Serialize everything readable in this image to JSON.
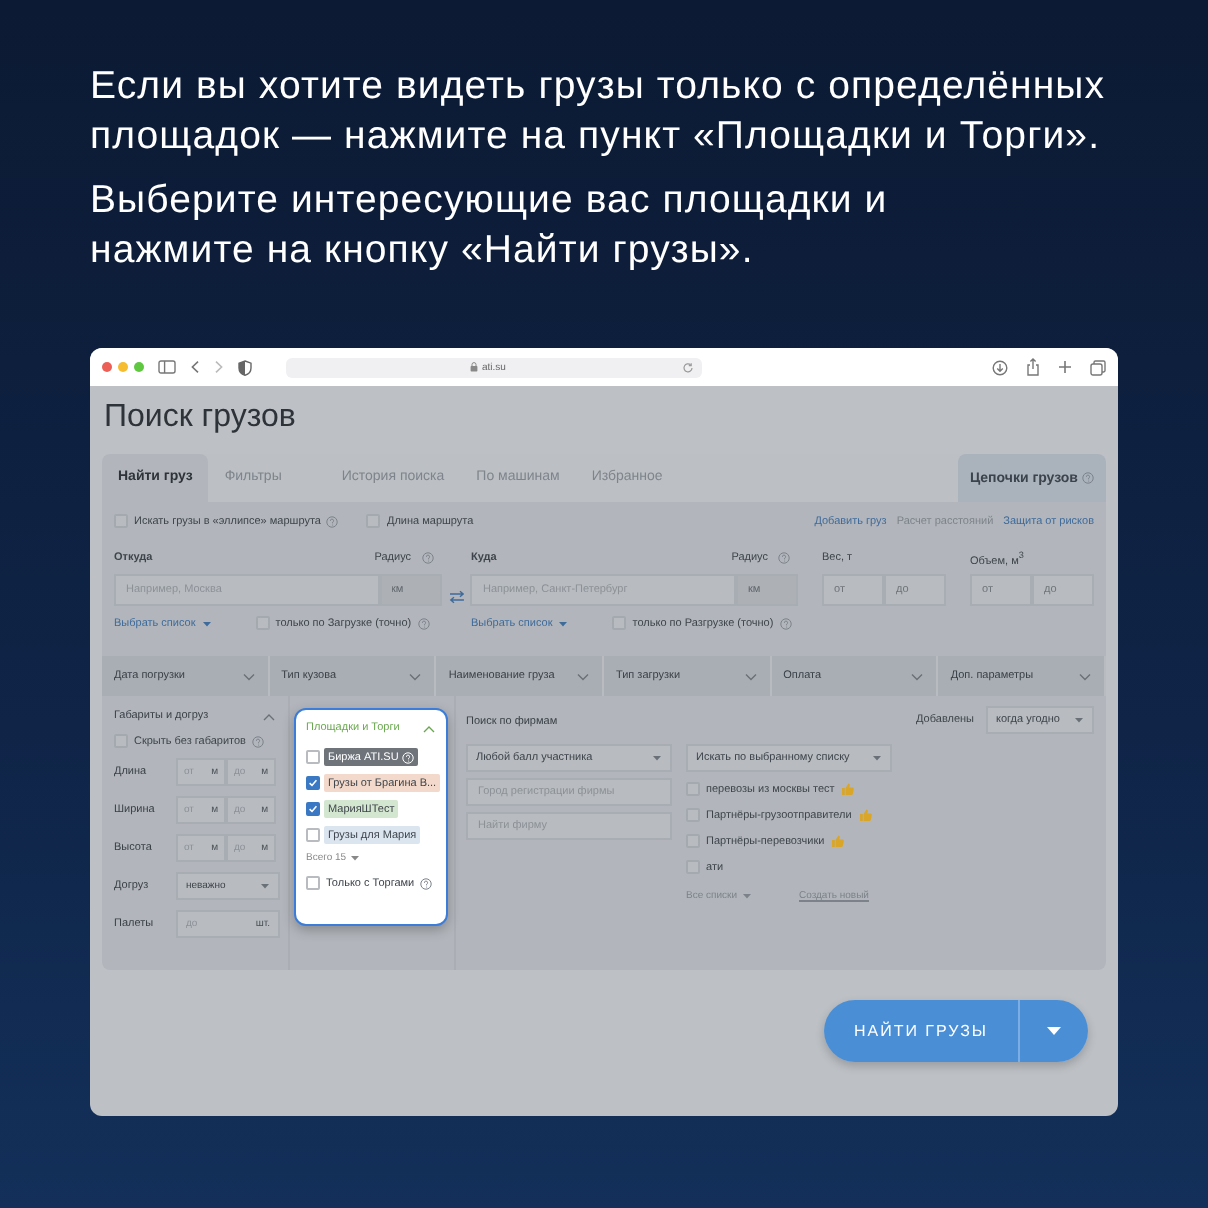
{
  "intro": [
    "Если вы хотите видеть грузы только с определённых площадок — нажмите на пункт «Площадки и Торги».",
    "Выберите интересующие вас площадки и нажмите на кнопку «Найти грузы»."
  ],
  "browser": {
    "address": "ati.su"
  },
  "page_title": "Поиск грузов",
  "tabs": [
    {
      "label": "Найти груз",
      "selected": true
    },
    {
      "label": "Фильтры",
      "selected": false
    },
    {
      "label": "История поиска",
      "selected": false
    },
    {
      "label": "По машинам",
      "selected": false
    },
    {
      "label": "Избранное",
      "selected": false
    }
  ],
  "chains_tab": {
    "label": "Цепочки грузов"
  },
  "options": [
    {
      "label": "Искать грузы в «эллипсе» маршрута",
      "checked": false,
      "help": true
    },
    {
      "label": "Длина маршрута",
      "checked": false,
      "help": false
    }
  ],
  "links": [
    {
      "label": "Добавить груз",
      "disabled": false
    },
    {
      "label": "Расчет расстояний",
      "disabled": true
    },
    {
      "label": "Защита от рисков",
      "disabled": false
    }
  ],
  "route": [
    {
      "label": "Откуда",
      "placeholder": "Например, Москва",
      "radius_label": "Радиус",
      "radius_placeholder": "км",
      "list_link": "Выбрать список",
      "exact": {
        "label": "только по Загрузке (точно)",
        "checked": false
      }
    },
    {
      "label": "Куда",
      "placeholder": "Например, Санкт-Петербург",
      "radius_label": "Радиус",
      "radius_placeholder": "км",
      "list_link": "Выбрать список",
      "exact": {
        "label": "только по Разгрузке (точно)",
        "checked": false
      }
    }
  ],
  "ranges": [
    {
      "label": "Вес, т",
      "from_placeholder": "от",
      "to_placeholder": "до"
    },
    {
      "label": "Объем, м$^{3}$",
      "from_placeholder": "от",
      "to_placeholder": "до"
    }
  ],
  "filter_columns": [
    "Дата погрузки",
    "Тип кузова",
    "Наименование груза",
    "Тип загрузки",
    "Оплата",
    "Доп. параметры"
  ],
  "dimensions": {
    "title": "Габариты и догруз",
    "hide": {
      "label": "Скрыть без габаритов",
      "checked": false
    },
    "rows": [
      {
        "label": "Длина",
        "from": "от",
        "from_unit": "м",
        "to": "до",
        "to_unit": "м"
      },
      {
        "label": "Ширина",
        "from": "от",
        "from_unit": "м",
        "to": "до",
        "to_unit": "м"
      },
      {
        "label": "Высота",
        "from": "от",
        "from_unit": "м",
        "to": "до",
        "to_unit": "м"
      }
    ],
    "reload": {
      "label": "Догруз",
      "value": "неважно"
    },
    "pallets": {
      "label": "Палеты",
      "placeholder": "до",
      "unit": "шт."
    }
  },
  "platforms": {
    "title": "Площадки и Торги",
    "items": [
      {
        "label": "Биржа ATI.SU",
        "checked": false,
        "color": "#6f747b",
        "help": true
      },
      {
        "label": "Грузы от Брагина В...",
        "checked": true,
        "color": "#f3d9cb",
        "help": false
      },
      {
        "label": "МарияШТест",
        "checked": true,
        "color": "#d3e6cf",
        "help": false
      },
      {
        "label": "Грузы для Мария",
        "checked": false,
        "color": "#dbe5f0",
        "help": false
      }
    ],
    "total": "Всего 15",
    "auctions": {
      "label": "Только с Торгами",
      "checked": false
    }
  },
  "firms": {
    "title": "Поиск по фирмам",
    "rating": "Любой балл участника",
    "city_placeholder": "Город регистрации фирмы",
    "name_placeholder": "Найти фирму",
    "list_select": "Искать по выбранному списку",
    "lists": [
      {
        "label": "перевозы из москвы тест",
        "checked": false,
        "liked": true
      },
      {
        "label": "Партнёры-грузоотправители",
        "checked": false,
        "liked": true
      },
      {
        "label": "Партнёры-перевозчики",
        "checked": false,
        "liked": true
      },
      {
        "label": "ати",
        "checked": false,
        "liked": false
      }
    ],
    "all_lists": "Все списки",
    "create": "Создать новый"
  },
  "added": {
    "label": "Добавлены",
    "value": "когда угодно"
  },
  "search_button": "НАЙТИ ГРУЗЫ"
}
